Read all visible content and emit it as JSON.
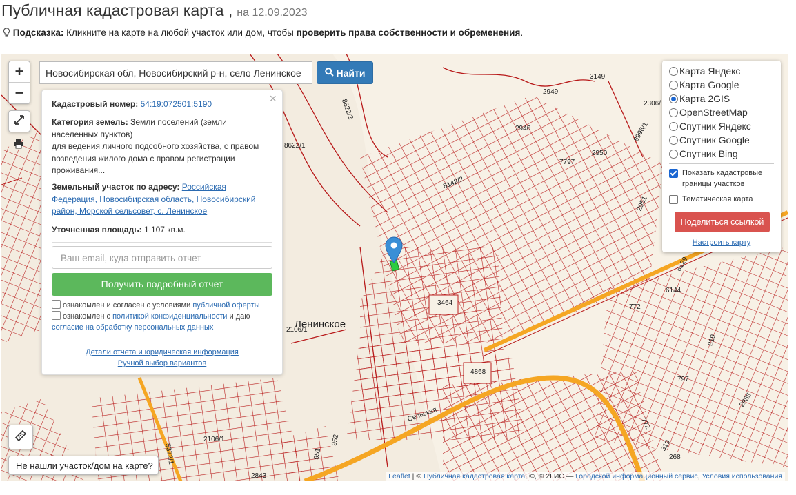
{
  "page": {
    "title": "Публичная кадастровая карта ,",
    "date": "на 12.09.2023",
    "hint_label": "Подсказка:",
    "hint_text": "Кликните на карте на любой участок или дом, чтобы",
    "hint_bold": "проверить права собственности и обременения",
    "hint_end": "."
  },
  "search": {
    "value": "Новосибирская обл, Новосибирский р-н, село Ленинское",
    "button_label": "Найти"
  },
  "zoom": {
    "in": "+",
    "out": "−"
  },
  "info_panel": {
    "cadastral_label": "Кадастровый номер:",
    "cadastral_number": "54:19:072501:5190",
    "category_label": "Категория земель:",
    "category_value": "Земли поселений (земли населенных пунктов)",
    "usage_value": "для ведения личного подсобного хозяйства, с правом возведения жилого дома с правом регистрации проживания...",
    "address_label": "Земельный участок по адресу:",
    "address_value": "Российская Федерация, Новосибирская область, Новосибирский район, Морской сельсовет, с. Ленинское",
    "area_label": "Уточненная площадь:",
    "area_value": "1 107 кв.м.",
    "email_placeholder": "Ваш email, куда отправить отчет",
    "get_report_button": "Получить подробный отчет",
    "agree1_text": "ознакомлен и согласен с условиями",
    "agree1_link": "публичной оферты",
    "agree2_text": "ознакомлен с",
    "agree2_link": "политикой конфиденциальности",
    "agree2_mid": "и даю",
    "agree2_link2": "согласие на обработку персональных данных",
    "details_link": "Детали отчета и юридическая информация",
    "manual_link": "Ручной выбор вариантов",
    "close": "×"
  },
  "layers": {
    "options": [
      {
        "label": "Карта Яндекс",
        "selected": false
      },
      {
        "label": "Карта Google",
        "selected": false
      },
      {
        "label": "Карта 2GIS",
        "selected": true
      },
      {
        "label": "OpenStreetMap",
        "selected": false
      },
      {
        "label": "Спутник Яндекс",
        "selected": false
      },
      {
        "label": "Спутник Google",
        "selected": false
      },
      {
        "label": "Спутник Bing",
        "selected": false
      }
    ],
    "show_borders_label": "Показать кадастровые границы участков",
    "show_borders_checked": true,
    "thematic_label": "Тематическая карта",
    "thematic_checked": false,
    "share_button": "Поделиться ссылкой",
    "configure_link": "Настроить карту"
  },
  "map": {
    "village_name": "Ленинское",
    "labels": [
      "3149",
      "2949",
      "2946",
      "2306/",
      "8996/1",
      "2950",
      "7797",
      "8622/2",
      "8622/1",
      "8142/2",
      "2951",
      "6129",
      "6144",
      "772",
      "3464",
      "4868",
      "2106/1",
      "2106/1",
      "819",
      "797",
      "2985",
      "772",
      "319",
      "268",
      "952",
      "951",
      "2843",
      "5372/1",
      "Сельская"
    ],
    "accent_plot_color": "#2ecc40",
    "parcel_line_color": "#b81a1a",
    "road_color": "#f5a623"
  },
  "not_found_button": "Не нашли участок/дом на карте?",
  "attribution": {
    "leaflet": "Leaflet",
    "sep1": "|",
    "copyright": "©",
    "pkk_link": "Публичная кадастровая карта",
    "mid": ", ©, © 2ГИС —",
    "gis_link": "Городской информационный сервис",
    "terms_link": "Условия использования"
  }
}
